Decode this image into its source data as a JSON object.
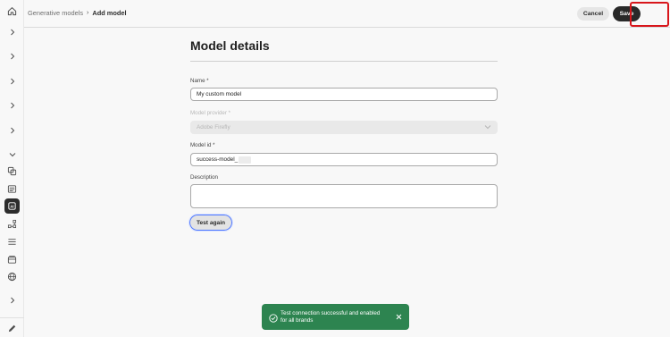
{
  "breadcrumb": {
    "parent": "Generative models",
    "separator": "›",
    "current": "Add model"
  },
  "actions": {
    "cancel_label": "Cancel",
    "save_label": "Save"
  },
  "form": {
    "title": "Model details",
    "name": {
      "label": "Name",
      "required_mark": "*",
      "value": "My custom model"
    },
    "provider": {
      "label": "Model provider",
      "required_mark": "*",
      "value": "Adobe Firefly",
      "disabled": true
    },
    "model_id": {
      "label": "Model id",
      "required_mark": "*",
      "value": "success-model_"
    },
    "description": {
      "label": "Description",
      "value": ""
    },
    "test_button_label": "Test again"
  },
  "toast": {
    "message": "Test connection successful and enabled for all brands",
    "status": "success",
    "color": "#2d8450"
  },
  "rail": {
    "icons": [
      "home-icon",
      "chevron-right-icon",
      "chevron-right-icon",
      "chevron-right-icon",
      "chevron-right-icon",
      "chevron-right-icon",
      "chevron-down-icon",
      "content-icon",
      "template-icon",
      "ai-model-icon",
      "workflow-icon",
      "list-icon",
      "cards-icon",
      "globe-icon",
      "chevron-right-icon",
      "edit-icon"
    ]
  },
  "colors": {
    "highlight": "#d8161b",
    "focus_ring": "#4b75ff"
  }
}
